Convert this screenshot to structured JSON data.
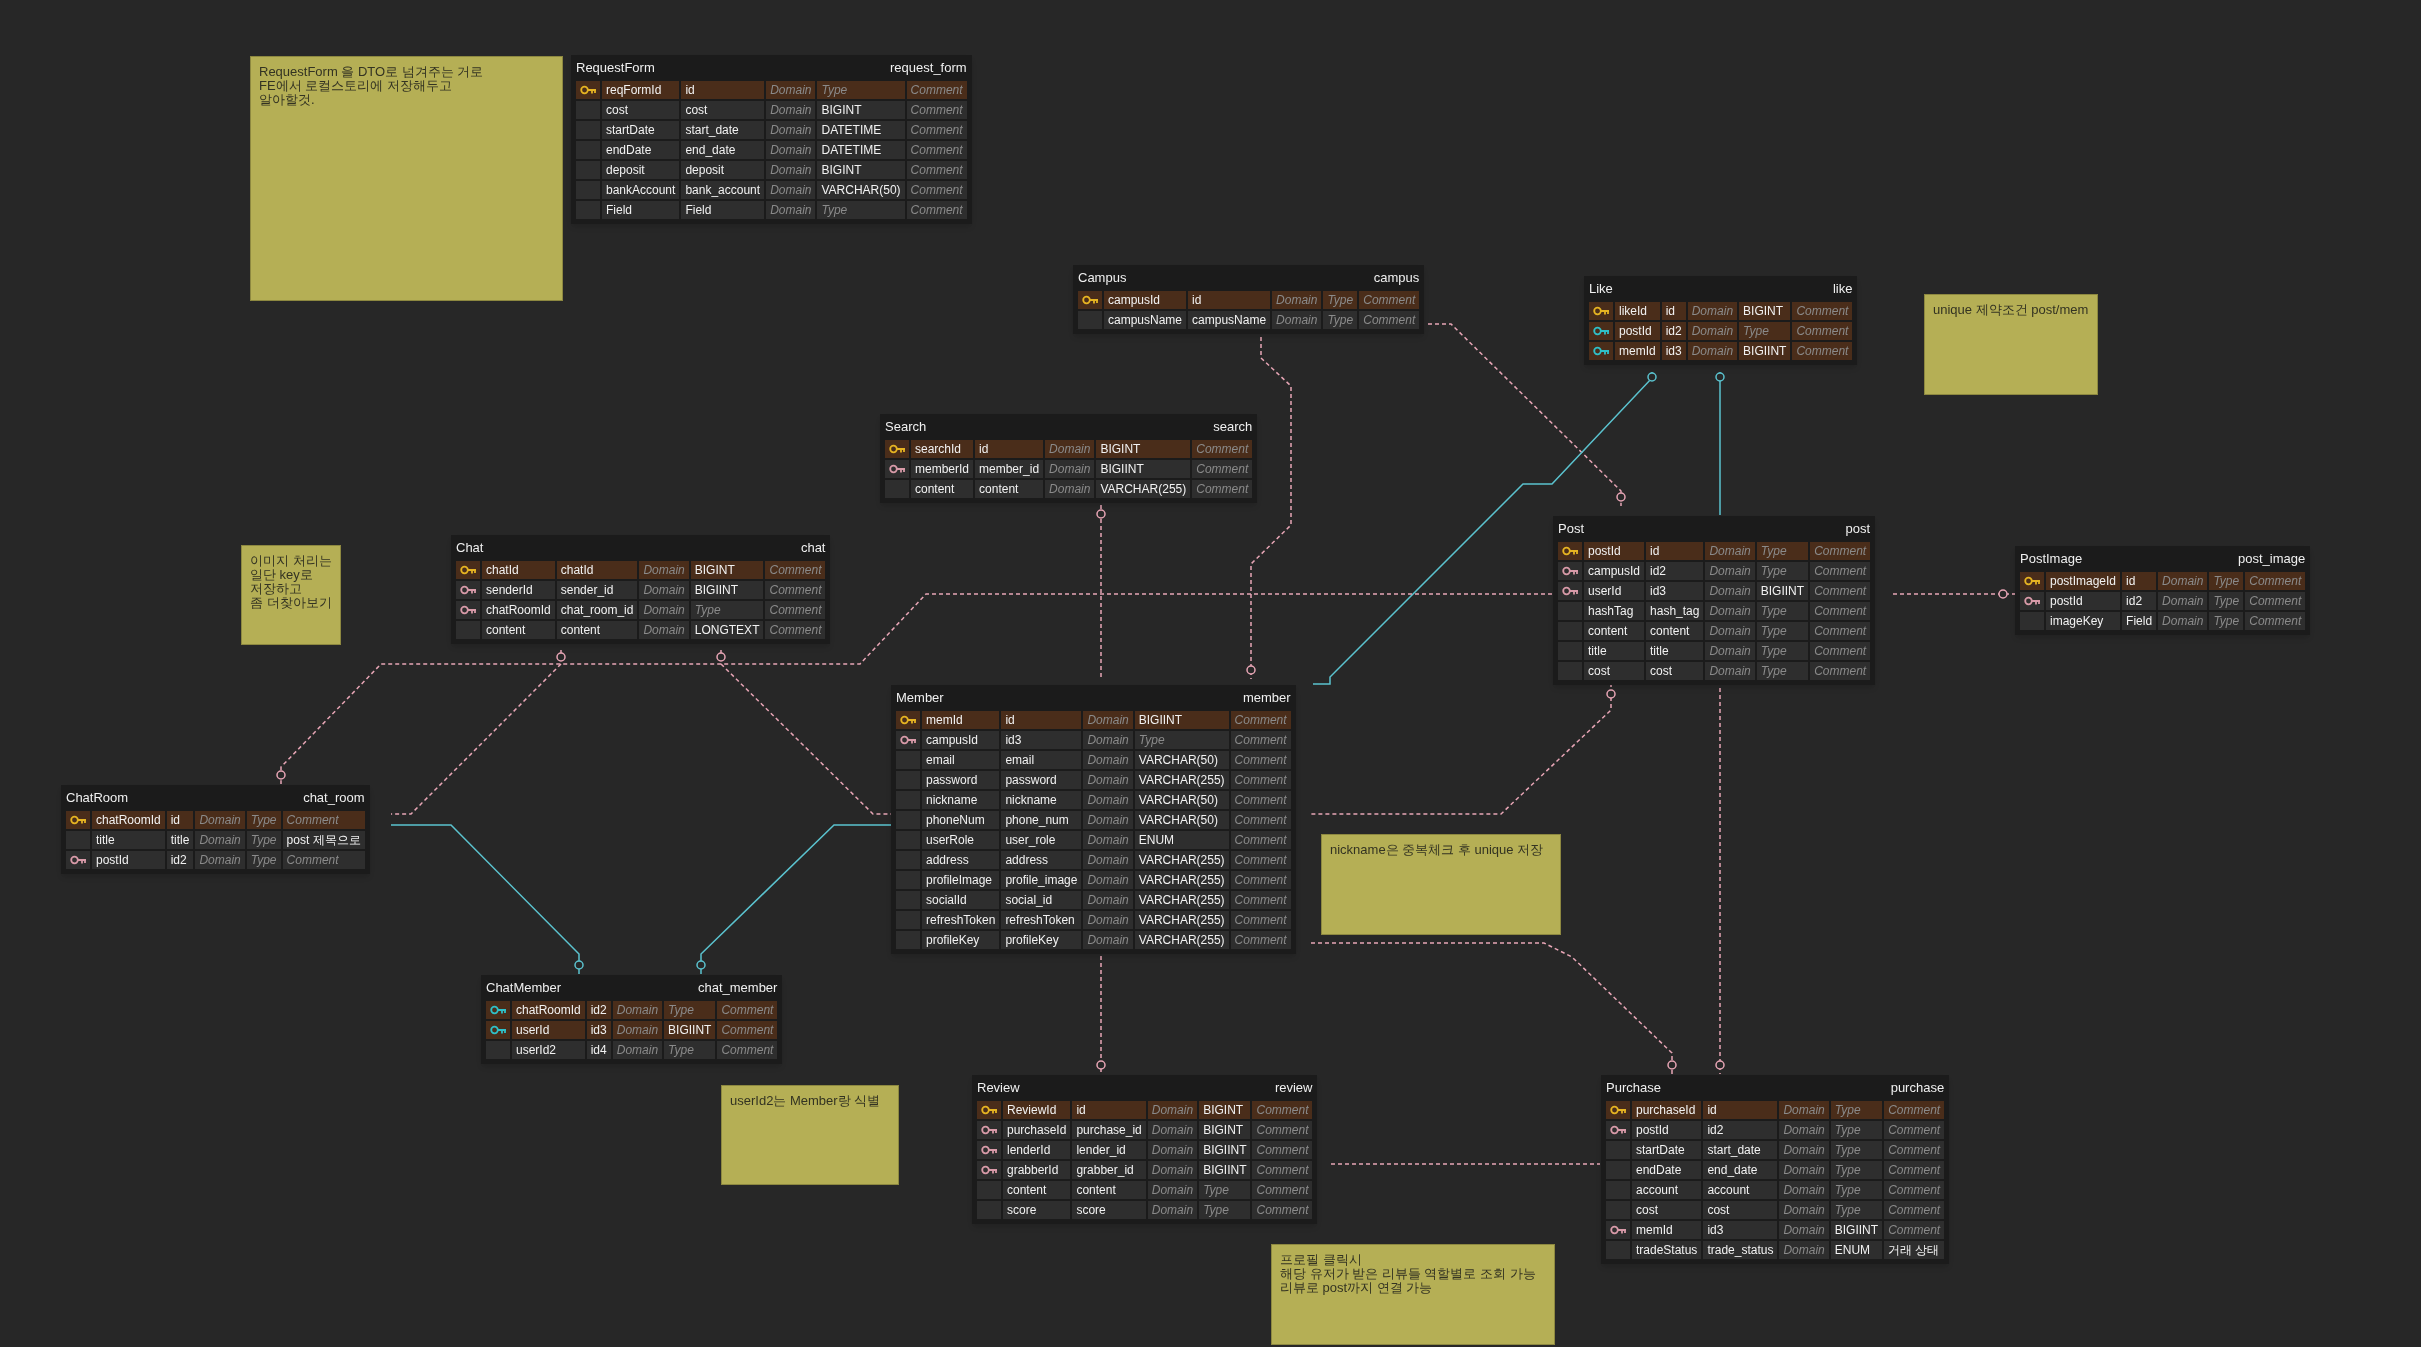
{
  "canvas": {
    "memos": [
      {
        "text": "RequestForm 을 DTO로 넘겨주는 거로\nFE에서 로컬스토리에 저장해두고\n알아할것."
      },
      {
        "text": "이미지 처리는\n일단 key로\n저장하고\n좀 더찾아보기"
      },
      {
        "text": "unique 제약조건 post/mem"
      },
      {
        "text": "nickname은 중복체크 후 unique 저장"
      },
      {
        "text": "userId2는 Member랑 식별"
      },
      {
        "text": "프로필 클릭시\n해당 유저가 받은 리뷰들 역할별로 조회 가능\n리뷰로 post까지 연결 가능"
      }
    ],
    "tables": [
      {
        "name": "RequestForm",
        "physical_name": "request_form",
        "columns": [
          {
            "kind": "pk",
            "name": "reqFormId",
            "physical_name": "id",
            "domain": "Domain",
            "type": "Type",
            "type_placeholder": true,
            "comment": "Comment",
            "comment_placeholder": true
          },
          {
            "kind": "none",
            "name": "cost",
            "physical_name": "cost",
            "domain": "Domain",
            "type": "BIGINT",
            "type_placeholder": false,
            "comment": "Comment",
            "comment_placeholder": true
          },
          {
            "kind": "none",
            "name": "startDate",
            "physical_name": "start_date",
            "domain": "Domain",
            "type": "DATETIME",
            "type_placeholder": false,
            "comment": "Comment",
            "comment_placeholder": true
          },
          {
            "kind": "none",
            "name": "endDate",
            "physical_name": "end_date",
            "domain": "Domain",
            "type": "DATETIME",
            "type_placeholder": false,
            "comment": "Comment",
            "comment_placeholder": true
          },
          {
            "kind": "none",
            "name": "deposit",
            "physical_name": "deposit",
            "domain": "Domain",
            "type": "BIGINT",
            "type_placeholder": false,
            "comment": "Comment",
            "comment_placeholder": true
          },
          {
            "kind": "none",
            "name": "bankAccount",
            "physical_name": "bank_account",
            "domain": "Domain",
            "type": "VARCHAR(50)",
            "type_placeholder": false,
            "comment": "Comment",
            "comment_placeholder": true
          },
          {
            "kind": "none",
            "name": "Field",
            "physical_name": "Field",
            "domain": "Domain",
            "type": "Type",
            "type_placeholder": true,
            "comment": "Comment",
            "comment_placeholder": true
          }
        ]
      },
      {
        "name": "Campus",
        "physical_name": "campus",
        "columns": [
          {
            "kind": "pk",
            "name": "campusId",
            "physical_name": "id",
            "domain": "Domain",
            "type": "Type",
            "type_placeholder": true,
            "comment": "Comment",
            "comment_placeholder": true
          },
          {
            "kind": "none",
            "name": "campusName",
            "physical_name": "campusName",
            "domain": "Domain",
            "type": "Type",
            "type_placeholder": true,
            "comment": "Comment",
            "comment_placeholder": true
          }
        ]
      },
      {
        "name": "Like",
        "physical_name": "like",
        "columns": [
          {
            "kind": "pk",
            "name": "likeId",
            "physical_name": "id",
            "domain": "Domain",
            "type": "BIGINT",
            "type_placeholder": false,
            "comment": "Comment",
            "comment_placeholder": true
          },
          {
            "kind": "pfk",
            "name": "postId",
            "physical_name": "id2",
            "domain": "Domain",
            "type": "Type",
            "type_placeholder": true,
            "comment": "Comment",
            "comment_placeholder": true
          },
          {
            "kind": "pfk",
            "name": "memId",
            "physical_name": "id3",
            "domain": "Domain",
            "type": "BIGIINT",
            "type_placeholder": false,
            "comment": "Comment",
            "comment_placeholder": true
          }
        ]
      },
      {
        "name": "Search",
        "physical_name": "search",
        "columns": [
          {
            "kind": "pk",
            "name": "searchId",
            "physical_name": "id",
            "domain": "Domain",
            "type": "BIGINT",
            "type_placeholder": false,
            "comment": "Comment",
            "comment_placeholder": true
          },
          {
            "kind": "fk",
            "name": "memberId",
            "physical_name": "member_id",
            "domain": "Domain",
            "type": "BIGIINT",
            "type_placeholder": false,
            "comment": "Comment",
            "comment_placeholder": true
          },
          {
            "kind": "none",
            "name": "content",
            "physical_name": "content",
            "domain": "Domain",
            "type": "VARCHAR(255)",
            "type_placeholder": false,
            "comment": "Comment",
            "comment_placeholder": true
          }
        ]
      },
      {
        "name": "Chat",
        "physical_name": "chat",
        "columns": [
          {
            "kind": "pk",
            "name": "chatId",
            "physical_name": "chatId",
            "domain": "Domain",
            "type": "BIGINT",
            "type_placeholder": false,
            "comment": "Comment",
            "comment_placeholder": true
          },
          {
            "kind": "fk",
            "name": "senderId",
            "physical_name": "sender_id",
            "domain": "Domain",
            "type": "BIGIINT",
            "type_placeholder": false,
            "comment": "Comment",
            "comment_placeholder": true
          },
          {
            "kind": "fk",
            "name": "chatRoomId",
            "physical_name": "chat_room_id",
            "domain": "Domain",
            "type": "Type",
            "type_placeholder": true,
            "comment": "Comment",
            "comment_placeholder": true
          },
          {
            "kind": "none",
            "name": "content",
            "physical_name": "content",
            "domain": "Domain",
            "type": "LONGTEXT",
            "type_placeholder": false,
            "comment": "Comment",
            "comment_placeholder": true
          }
        ]
      },
      {
        "name": "Post",
        "physical_name": "post",
        "columns": [
          {
            "kind": "pk",
            "name": "postId",
            "physical_name": "id",
            "domain": "Domain",
            "type": "Type",
            "type_placeholder": true,
            "comment": "Comment",
            "comment_placeholder": true
          },
          {
            "kind": "fk",
            "name": "campusId",
            "physical_name": "id2",
            "domain": "Domain",
            "type": "Type",
            "type_placeholder": true,
            "comment": "Comment",
            "comment_placeholder": true
          },
          {
            "kind": "fk",
            "name": "userId",
            "physical_name": "id3",
            "domain": "Domain",
            "type": "BIGIINT",
            "type_placeholder": false,
            "comment": "Comment",
            "comment_placeholder": true
          },
          {
            "kind": "none",
            "name": "hashTag",
            "physical_name": "hash_tag",
            "domain": "Domain",
            "type": "Type",
            "type_placeholder": true,
            "comment": "Comment",
            "comment_placeholder": true
          },
          {
            "kind": "none",
            "name": "content",
            "physical_name": "content",
            "domain": "Domain",
            "type": "Type",
            "type_placeholder": true,
            "comment": "Comment",
            "comment_placeholder": true
          },
          {
            "kind": "none",
            "name": "title",
            "physical_name": "title",
            "domain": "Domain",
            "type": "Type",
            "type_placeholder": true,
            "comment": "Comment",
            "comment_placeholder": true
          },
          {
            "kind": "none",
            "name": "cost",
            "physical_name": "cost",
            "domain": "Domain",
            "type": "Type",
            "type_placeholder": true,
            "comment": "Comment",
            "comment_placeholder": true
          }
        ]
      },
      {
        "name": "PostImage",
        "physical_name": "post_image",
        "columns": [
          {
            "kind": "pk",
            "name": "postImageId",
            "physical_name": "id",
            "domain": "Domain",
            "type": "Type",
            "type_placeholder": true,
            "comment": "Comment",
            "comment_placeholder": true
          },
          {
            "kind": "fk",
            "name": "postId",
            "physical_name": "id2",
            "domain": "Domain",
            "type": "Type",
            "type_placeholder": true,
            "comment": "Comment",
            "comment_placeholder": true
          },
          {
            "kind": "none",
            "name": "imageKey",
            "physical_name": "Field",
            "domain": "Domain",
            "type": "Type",
            "type_placeholder": true,
            "comment": "Comment",
            "comment_placeholder": true
          }
        ]
      },
      {
        "name": "ChatRoom",
        "physical_name": "chat_room",
        "columns": [
          {
            "kind": "pk",
            "name": "chatRoomId",
            "physical_name": "id",
            "domain": "Domain",
            "type": "Type",
            "type_placeholder": true,
            "comment": "Comment",
            "comment_placeholder": true
          },
          {
            "kind": "none",
            "name": "title",
            "physical_name": "title",
            "domain": "Domain",
            "type": "Type",
            "type_placeholder": true,
            "comment": "post 제목으로",
            "comment_placeholder": false
          },
          {
            "kind": "fk",
            "name": "postId",
            "physical_name": "id2",
            "domain": "Domain",
            "type": "Type",
            "type_placeholder": true,
            "comment": "Comment",
            "comment_placeholder": true
          }
        ]
      },
      {
        "name": "Member",
        "physical_name": "member",
        "columns": [
          {
            "kind": "pk",
            "name": "memId",
            "physical_name": "id",
            "domain": "Domain",
            "type": "BIGIINT",
            "type_placeholder": false,
            "comment": "Comment",
            "comment_placeholder": true
          },
          {
            "kind": "fk",
            "name": "campusId",
            "physical_name": "id3",
            "domain": "Domain",
            "type": "Type",
            "type_placeholder": true,
            "comment": "Comment",
            "comment_placeholder": true
          },
          {
            "kind": "none",
            "name": "email",
            "physical_name": "email",
            "domain": "Domain",
            "type": "VARCHAR(50)",
            "type_placeholder": false,
            "comment": "Comment",
            "comment_placeholder": true
          },
          {
            "kind": "none",
            "name": "password",
            "physical_name": "password",
            "domain": "Domain",
            "type": "VARCHAR(255)",
            "type_placeholder": false,
            "comment": "Comment",
            "comment_placeholder": true
          },
          {
            "kind": "none",
            "name": "nickname",
            "physical_name": "nickname",
            "domain": "Domain",
            "type": "VARCHAR(50)",
            "type_placeholder": false,
            "comment": "Comment",
            "comment_placeholder": true
          },
          {
            "kind": "none",
            "name": "phoneNum",
            "physical_name": "phone_num",
            "domain": "Domain",
            "type": "VARCHAR(50)",
            "type_placeholder": false,
            "comment": "Comment",
            "comment_placeholder": true
          },
          {
            "kind": "none",
            "name": "userRole",
            "physical_name": "user_role",
            "domain": "Domain",
            "type": "ENUM",
            "type_placeholder": false,
            "comment": "Comment",
            "comment_placeholder": true
          },
          {
            "kind": "none",
            "name": "address",
            "physical_name": "address",
            "domain": "Domain",
            "type": "VARCHAR(255)",
            "type_placeholder": false,
            "comment": "Comment",
            "comment_placeholder": true
          },
          {
            "kind": "none",
            "name": "profileImage",
            "physical_name": "profile_image",
            "domain": "Domain",
            "type": "VARCHAR(255)",
            "type_placeholder": false,
            "comment": "Comment",
            "comment_placeholder": true
          },
          {
            "kind": "none",
            "name": "socialId",
            "physical_name": "social_id",
            "domain": "Domain",
            "type": "VARCHAR(255)",
            "type_placeholder": false,
            "comment": "Comment",
            "comment_placeholder": true
          },
          {
            "kind": "none",
            "name": "refreshToken",
            "physical_name": "refreshToken",
            "domain": "Domain",
            "type": "VARCHAR(255)",
            "type_placeholder": false,
            "comment": "Comment",
            "comment_placeholder": true
          },
          {
            "kind": "none",
            "name": "profileKey",
            "physical_name": "profileKey",
            "domain": "Domain",
            "type": "VARCHAR(255)",
            "type_placeholder": false,
            "comment": "Comment",
            "comment_placeholder": true
          }
        ]
      },
      {
        "name": "ChatMember",
        "physical_name": "chat_member",
        "columns": [
          {
            "kind": "pfk",
            "name": "chatRoomId",
            "physical_name": "id2",
            "domain": "Domain",
            "type": "Type",
            "type_placeholder": true,
            "comment": "Comment",
            "comment_placeholder": true
          },
          {
            "kind": "pfk",
            "name": "userId",
            "physical_name": "id3",
            "domain": "Domain",
            "type": "BIGIINT",
            "type_placeholder": false,
            "comment": "Comment",
            "comment_placeholder": true
          },
          {
            "kind": "none",
            "name": "userId2",
            "physical_name": "id4",
            "domain": "Domain",
            "type": "Type",
            "type_placeholder": true,
            "comment": "Comment",
            "comment_placeholder": true
          }
        ]
      },
      {
        "name": "Review",
        "physical_name": "review",
        "columns": [
          {
            "kind": "pk",
            "name": "ReviewId",
            "physical_name": "id",
            "domain": "Domain",
            "type": "BIGINT",
            "type_placeholder": false,
            "comment": "Comment",
            "comment_placeholder": true
          },
          {
            "kind": "fk",
            "name": "purchaseId",
            "physical_name": "purchase_id",
            "domain": "Domain",
            "type": "BIGINT",
            "type_placeholder": false,
            "comment": "Comment",
            "comment_placeholder": true
          },
          {
            "kind": "fk",
            "name": "lenderId",
            "physical_name": "lender_id",
            "domain": "Domain",
            "type": "BIGIINT",
            "type_placeholder": false,
            "comment": "Comment",
            "comment_placeholder": true
          },
          {
            "kind": "fk",
            "name": "grabberId",
            "physical_name": "grabber_id",
            "domain": "Domain",
            "type": "BIGIINT",
            "type_placeholder": false,
            "comment": "Comment",
            "comment_placeholder": true
          },
          {
            "kind": "none",
            "name": "content",
            "physical_name": "content",
            "domain": "Domain",
            "type": "Type",
            "type_placeholder": true,
            "comment": "Comment",
            "comment_placeholder": true
          },
          {
            "kind": "none",
            "name": "score",
            "physical_name": "score",
            "domain": "Domain",
            "type": "Type",
            "type_placeholder": true,
            "comment": "Comment",
            "comment_placeholder": true
          }
        ]
      },
      {
        "name": "Purchase",
        "physical_name": "purchase",
        "columns": [
          {
            "kind": "pk",
            "name": "purchaseId",
            "physical_name": "id",
            "domain": "Domain",
            "type": "Type",
            "type_placeholder": true,
            "comment": "Comment",
            "comment_placeholder": true
          },
          {
            "kind": "fk",
            "name": "postId",
            "physical_name": "id2",
            "domain": "Domain",
            "type": "Type",
            "type_placeholder": true,
            "comment": "Comment",
            "comment_placeholder": true
          },
          {
            "kind": "none",
            "name": "startDate",
            "physical_name": "start_date",
            "domain": "Domain",
            "type": "Type",
            "type_placeholder": true,
            "comment": "Comment",
            "comment_placeholder": true
          },
          {
            "kind": "none",
            "name": "endDate",
            "physical_name": "end_date",
            "domain": "Domain",
            "type": "Type",
            "type_placeholder": true,
            "comment": "Comment",
            "comment_placeholder": true
          },
          {
            "kind": "none",
            "name": "account",
            "physical_name": "account",
            "domain": "Domain",
            "type": "Type",
            "type_placeholder": true,
            "comment": "Comment",
            "comment_placeholder": true
          },
          {
            "kind": "none",
            "name": "cost",
            "physical_name": "cost",
            "domain": "Domain",
            "type": "Type",
            "type_placeholder": true,
            "comment": "Comment",
            "comment_placeholder": true
          },
          {
            "kind": "fk",
            "name": "memId",
            "physical_name": "id3",
            "domain": "Domain",
            "type": "BIGIINT",
            "type_placeholder": false,
            "comment": "Comment",
            "comment_placeholder": true
          },
          {
            "kind": "none",
            "name": "tradeStatus",
            "physical_name": "trade_status",
            "domain": "Domain",
            "type": "ENUM",
            "type_placeholder": false,
            "comment": "거래 상태",
            "comment_placeholder": false
          }
        ]
      }
    ]
  }
}
